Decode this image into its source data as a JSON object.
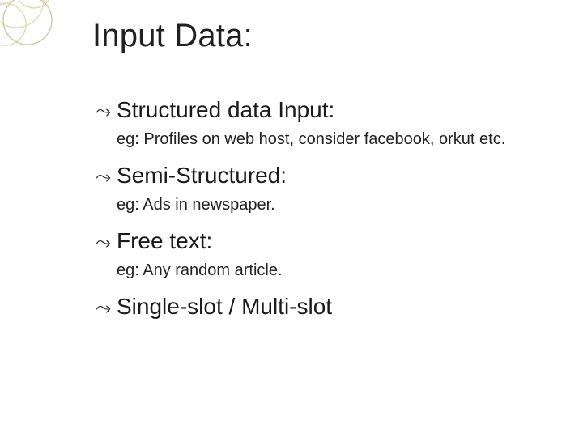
{
  "title": "Input Data:",
  "bullets": [
    {
      "label": "Structured data Input:",
      "sub": "eg: Profiles on web host, consider facebook, orkut etc."
    },
    {
      "label": "Semi-Structured:",
      "sub": "eg: Ads in newspaper."
    },
    {
      "label": "Free text:",
      "sub": "eg: Any random article."
    },
    {
      "label": "Single-slot / Multi-slot"
    }
  ],
  "bullet_glyph": "⤳"
}
